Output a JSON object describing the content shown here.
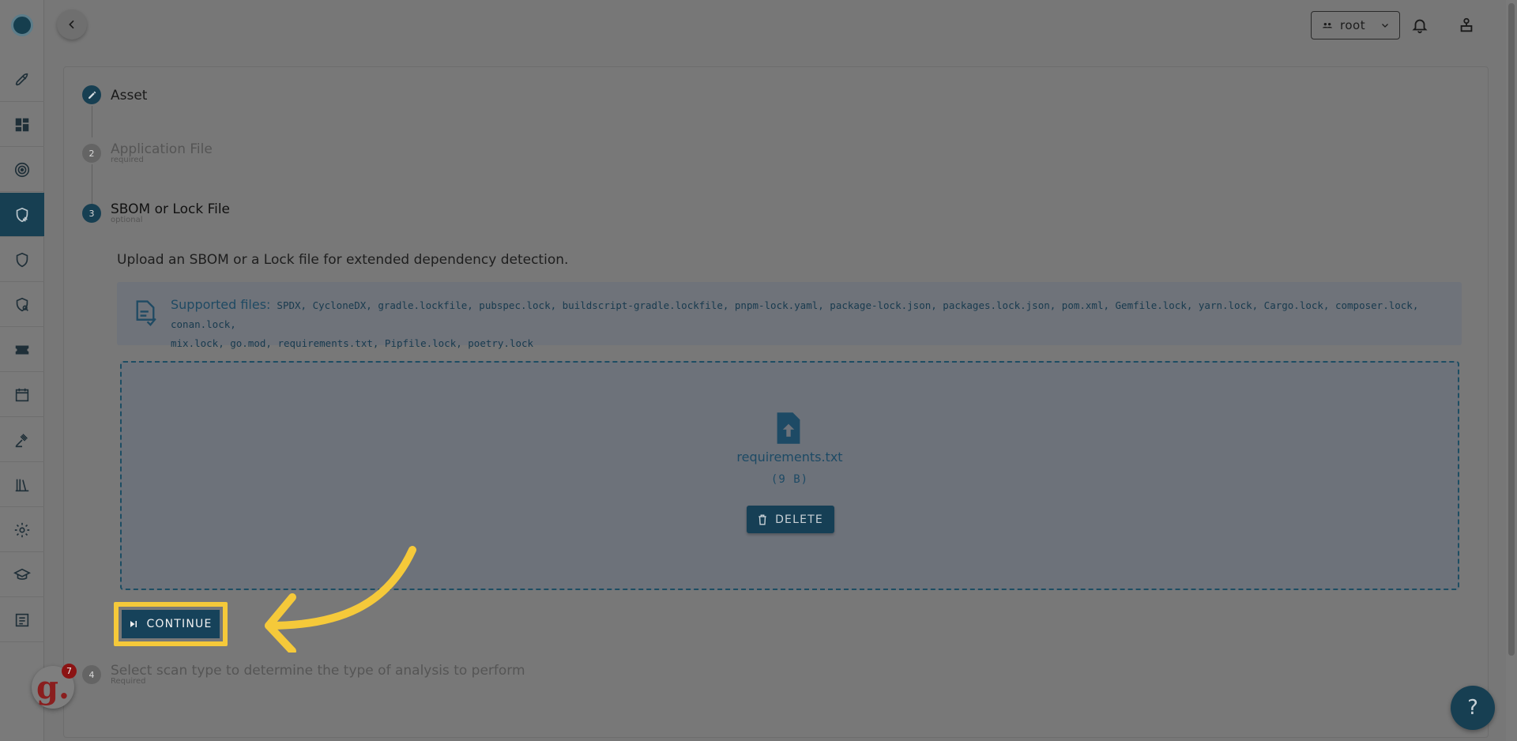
{
  "header": {
    "org_selector": {
      "value": "root"
    }
  },
  "sidebar": {
    "items": [
      {
        "icon": "rocket-icon"
      },
      {
        "icon": "dashboard-icon"
      },
      {
        "icon": "radar-icon"
      },
      {
        "icon": "shield-add-icon",
        "active": true
      },
      {
        "icon": "shield-icon"
      },
      {
        "icon": "shield-search-icon"
      },
      {
        "icon": "ticket-icon"
      },
      {
        "icon": "calendar-icon"
      },
      {
        "icon": "gavel-icon"
      },
      {
        "icon": "library-icon"
      },
      {
        "icon": "gear-icon"
      },
      {
        "icon": "graduation-cap-icon"
      },
      {
        "icon": "list-icon"
      }
    ]
  },
  "stepper": {
    "steps": [
      {
        "number": "",
        "title": "Asset",
        "subtitle": "",
        "state": "completed"
      },
      {
        "number": "2",
        "title": "Application File",
        "subtitle": "required",
        "state": "inactive"
      },
      {
        "number": "3",
        "title": "SBOM or Lock File",
        "subtitle": "optional",
        "state": "active"
      },
      {
        "number": "4",
        "title": "Select scan type to determine the type of analysis to perform",
        "subtitle": "Required",
        "state": "inactive"
      }
    ]
  },
  "upload": {
    "description": "Upload an SBOM or a Lock file for extended dependency detection.",
    "supported_label": "Supported files:",
    "supported_line1": "SPDX, CycloneDX, gradle.lockfile, pubspec.lock, buildscript-gradle.lockfile, pnpm-lock.yaml, package-lock.json, packages.lock.json, pom.xml, Gemfile.lock, yarn.lock, Cargo.lock, composer.lock, conan.lock,",
    "supported_line2": "mix.lock, go.mod, requirements.txt, Pipfile.lock, poetry.lock",
    "file_name": "requirements.txt",
    "file_size": "(9 B)",
    "delete_label": "DELETE",
    "continue_label": "CONTINUE"
  },
  "widgets": {
    "gleap_letter": "g.",
    "gleap_badge": "7",
    "help_label": "?"
  },
  "colors": {
    "primary": "#163f55",
    "highlight": "#f5c93a"
  }
}
